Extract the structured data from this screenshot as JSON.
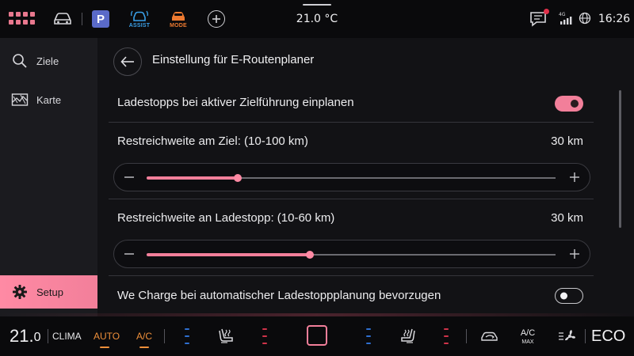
{
  "topbar": {
    "assist_label": "ASSIST",
    "mode_label": "MODE",
    "parking_label": "P",
    "temperature": "21.0 °C",
    "network": "4G",
    "clock": "16:26"
  },
  "sidebar": {
    "items": [
      {
        "label": "Ziele",
        "icon": "search-icon",
        "active": false
      },
      {
        "label": "Karte",
        "icon": "map-icon",
        "active": false
      },
      {
        "label": "Setup",
        "icon": "gear-icon",
        "active": true
      }
    ]
  },
  "main": {
    "title": "Einstellung für E-Routenplaner",
    "settings": [
      {
        "type": "toggle",
        "label": "Ladestopps bei aktiver Zielführung einplanen",
        "state": "on"
      },
      {
        "type": "slider",
        "label": "Restreichweite am Ziel: (10-100 km)",
        "value_text": "30 km",
        "value": 30,
        "min": 10,
        "max": 100
      },
      {
        "type": "slider",
        "label": "Restreichweite an Ladestopp: (10-60 km)",
        "value_text": "30 km",
        "value": 30,
        "min": 10,
        "max": 60
      },
      {
        "type": "toggle",
        "label": "We Charge bei automatischer Ladestoppplanung bevorzugen",
        "state": "off"
      }
    ]
  },
  "bottombar": {
    "temp_int": "21.",
    "temp_dec": "0",
    "clima_label": "CLIMA",
    "auto_label": "AUTO",
    "ac_label": "A/C",
    "acmax_top": "A/C",
    "acmax_bottom": "MAX",
    "eco_label": "ECO"
  },
  "colors": {
    "accent": "#f27f9a",
    "amber": "#ee8f3a",
    "heat_blue": "#2f6fd0",
    "heat_red": "#d0344a",
    "assist_blue": "#3aa0e8",
    "mode_orange": "#ee7a30",
    "parking_blue": "#5a6ac8"
  }
}
